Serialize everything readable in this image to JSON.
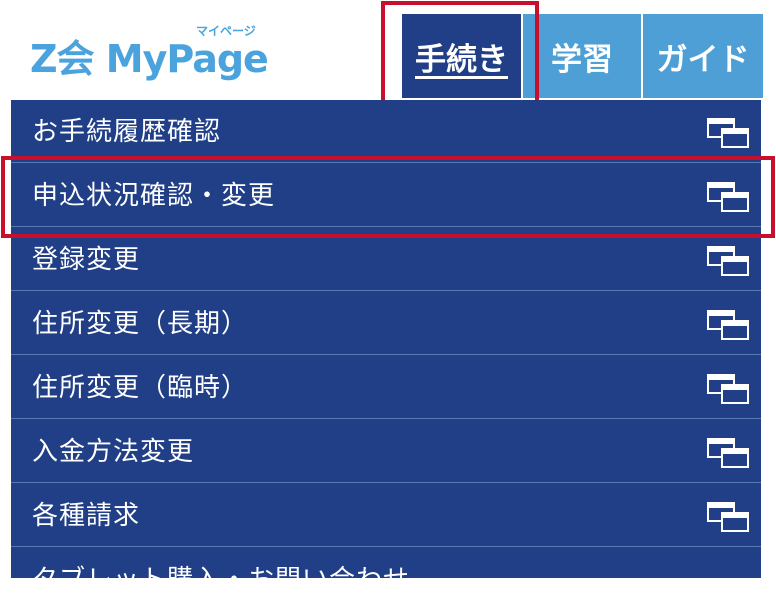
{
  "header": {
    "logo_text": "Z会 MyPage",
    "logo_sub": "マイページ"
  },
  "tabs": [
    {
      "label": "手続き",
      "active": true
    },
    {
      "label": "学習",
      "active": false
    },
    {
      "label": "ガイド",
      "active": false
    }
  ],
  "menu": {
    "items": [
      {
        "label": "お手続履歴確認",
        "icon": "new-window-icon"
      },
      {
        "label": "申込状況確認・変更",
        "icon": "new-window-icon"
      },
      {
        "label": "登録変更",
        "icon": "new-window-icon"
      },
      {
        "label": "住所変更（長期）",
        "icon": "new-window-icon"
      },
      {
        "label": "住所変更（臨時）",
        "icon": "new-window-icon"
      },
      {
        "label": "入金方法変更",
        "icon": "new-window-icon"
      },
      {
        "label": "各種請求",
        "icon": "new-window-icon"
      },
      {
        "label": "タブレット購入・お問い合わせ",
        "icon": "new-window-icon"
      }
    ]
  },
  "colors": {
    "menu_bg": "#213f87",
    "tab_inactive": "#4d9fd6",
    "logo": "#4aa3dc",
    "highlight": "#c8102e"
  }
}
